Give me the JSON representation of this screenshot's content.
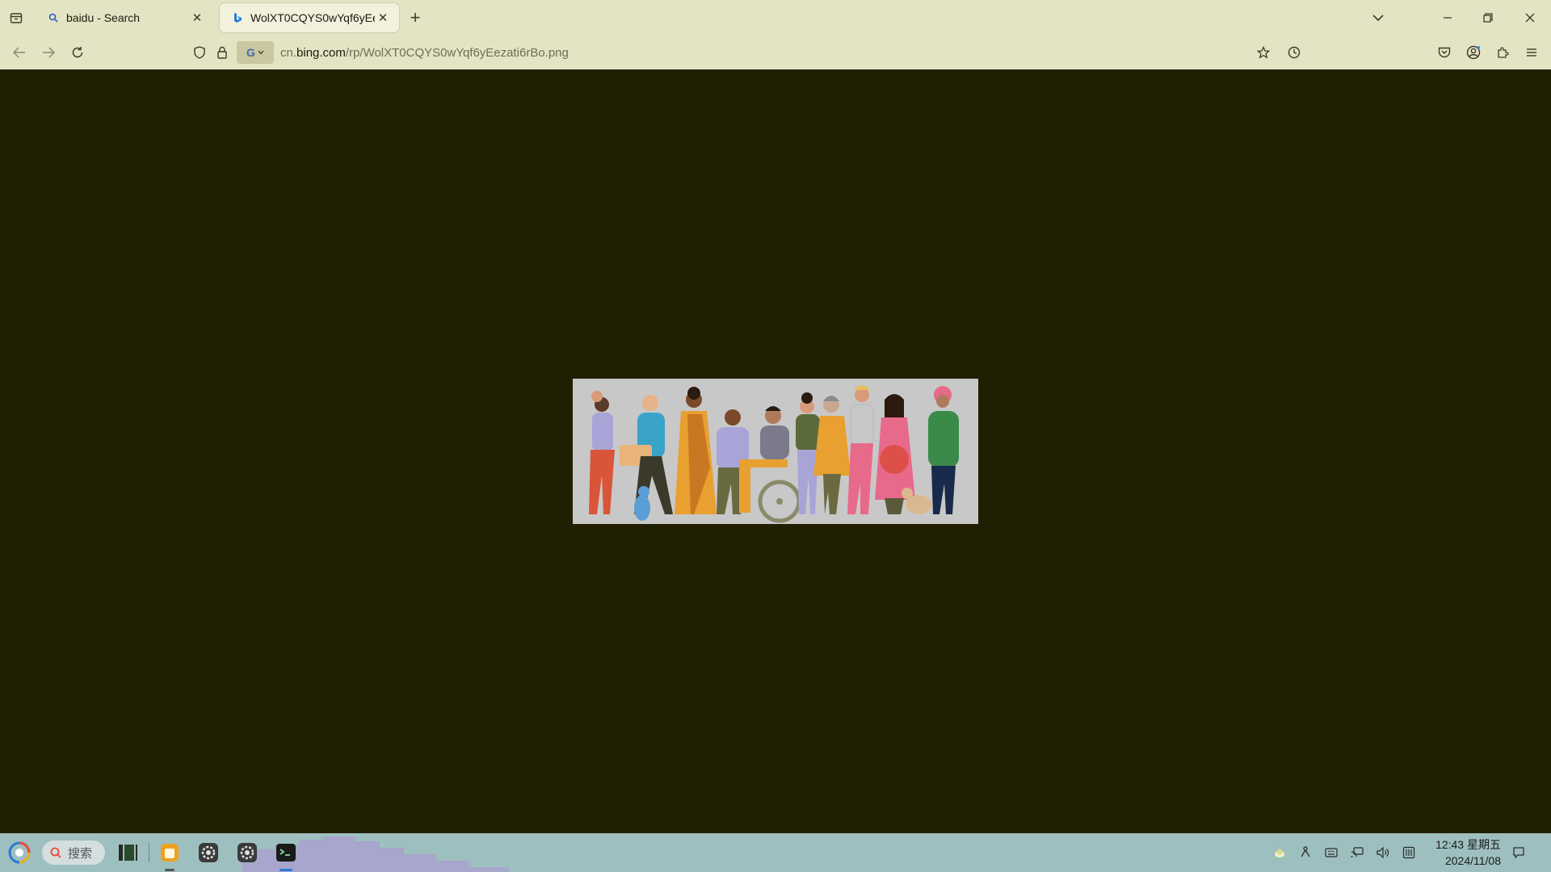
{
  "browser": {
    "tabs": [
      {
        "label": "baidu - Search",
        "favicon": "search-icon",
        "active": false
      },
      {
        "label": "WolXT0CQYS0wYqf6yEezat",
        "favicon": "bing-icon",
        "active": true
      }
    ],
    "new_tab_label": "+",
    "url": {
      "prefix": "cn.",
      "host": "bing.com",
      "path": "/rp/WolXT0CQYS0wYqf6yEezati6rBo.png"
    },
    "search_engine": "G"
  },
  "content": {
    "image_description_alt": "Illustration of diverse group of people",
    "background_color": "#211f02"
  },
  "taskbar": {
    "search_placeholder": "搜索",
    "clock_time": "12:43 星期五",
    "clock_date": "2024/11/08"
  },
  "colors": {
    "chrome": "#e4e3c4",
    "taskbar": "#9ebfbf"
  }
}
